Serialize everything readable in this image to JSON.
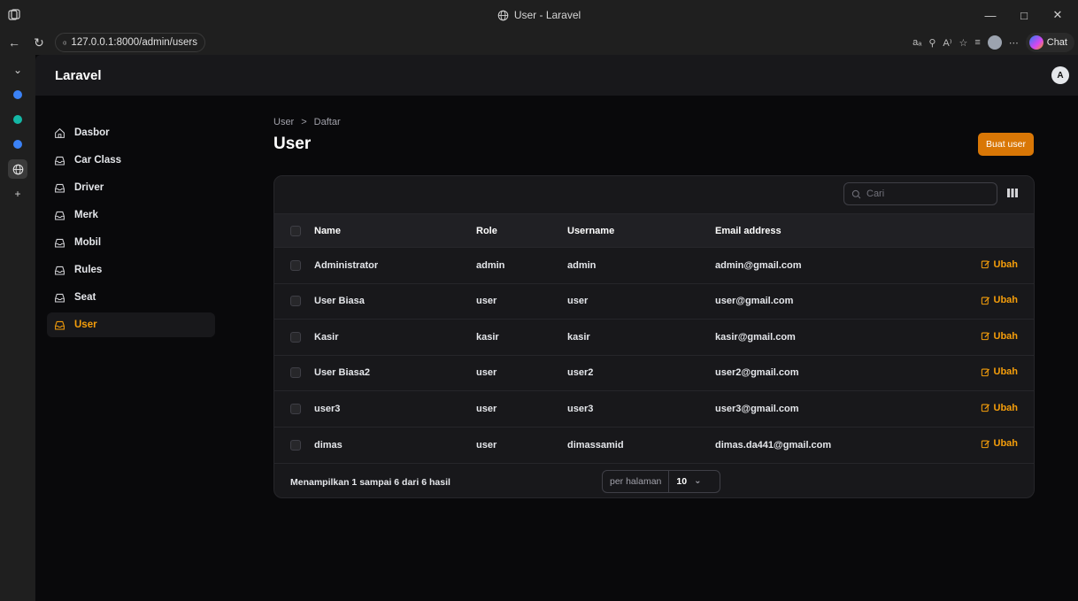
{
  "browser": {
    "window_title": "User - Laravel",
    "url": "127.0.0.1:8000/admin/users",
    "chat_label": "Chat"
  },
  "app": {
    "brand": "Laravel",
    "avatar_initial": "A"
  },
  "sidebar": {
    "items": [
      {
        "label": "Dasbor",
        "icon": "home-icon",
        "active": false
      },
      {
        "label": "Car Class",
        "icon": "inbox-icon",
        "active": false
      },
      {
        "label": "Driver",
        "icon": "inbox-icon",
        "active": false
      },
      {
        "label": "Merk",
        "icon": "inbox-icon",
        "active": false
      },
      {
        "label": "Mobil",
        "icon": "inbox-icon",
        "active": false
      },
      {
        "label": "Rules",
        "icon": "inbox-icon",
        "active": false
      },
      {
        "label": "Seat",
        "icon": "inbox-icon",
        "active": false
      },
      {
        "label": "User",
        "icon": "inbox-icon",
        "active": true
      }
    ]
  },
  "page": {
    "breadcrumb": [
      "User",
      ">",
      "Daftar"
    ],
    "title": "User",
    "create_button": "Buat user"
  },
  "table": {
    "search_placeholder": "Cari",
    "columns": [
      "Name",
      "Role",
      "Username",
      "Email address"
    ],
    "action_label": "Ubah",
    "rows": [
      {
        "name": "Administrator",
        "role": "admin",
        "username": "admin",
        "email": "admin@gmail.com"
      },
      {
        "name": "User Biasa",
        "role": "user",
        "username": "user",
        "email": "user@gmail.com"
      },
      {
        "name": "Kasir",
        "role": "kasir",
        "username": "kasir",
        "email": "kasir@gmail.com"
      },
      {
        "name": "User Biasa2",
        "role": "user",
        "username": "user2",
        "email": "user2@gmail.com"
      },
      {
        "name": "user3",
        "role": "user",
        "username": "user3",
        "email": "user3@gmail.com"
      },
      {
        "name": "dimas",
        "role": "user",
        "username": "dimassamid",
        "email": "dimas.da441@gmail.com"
      }
    ],
    "summary": "Menampilkan 1 sampai 6 dari 6 hasil",
    "per_page_label": "per halaman",
    "per_page_value": "10"
  },
  "colors": {
    "accent": "#f59e0b",
    "button": "#d97706",
    "background": "#09090b",
    "panel": "#18181b"
  }
}
